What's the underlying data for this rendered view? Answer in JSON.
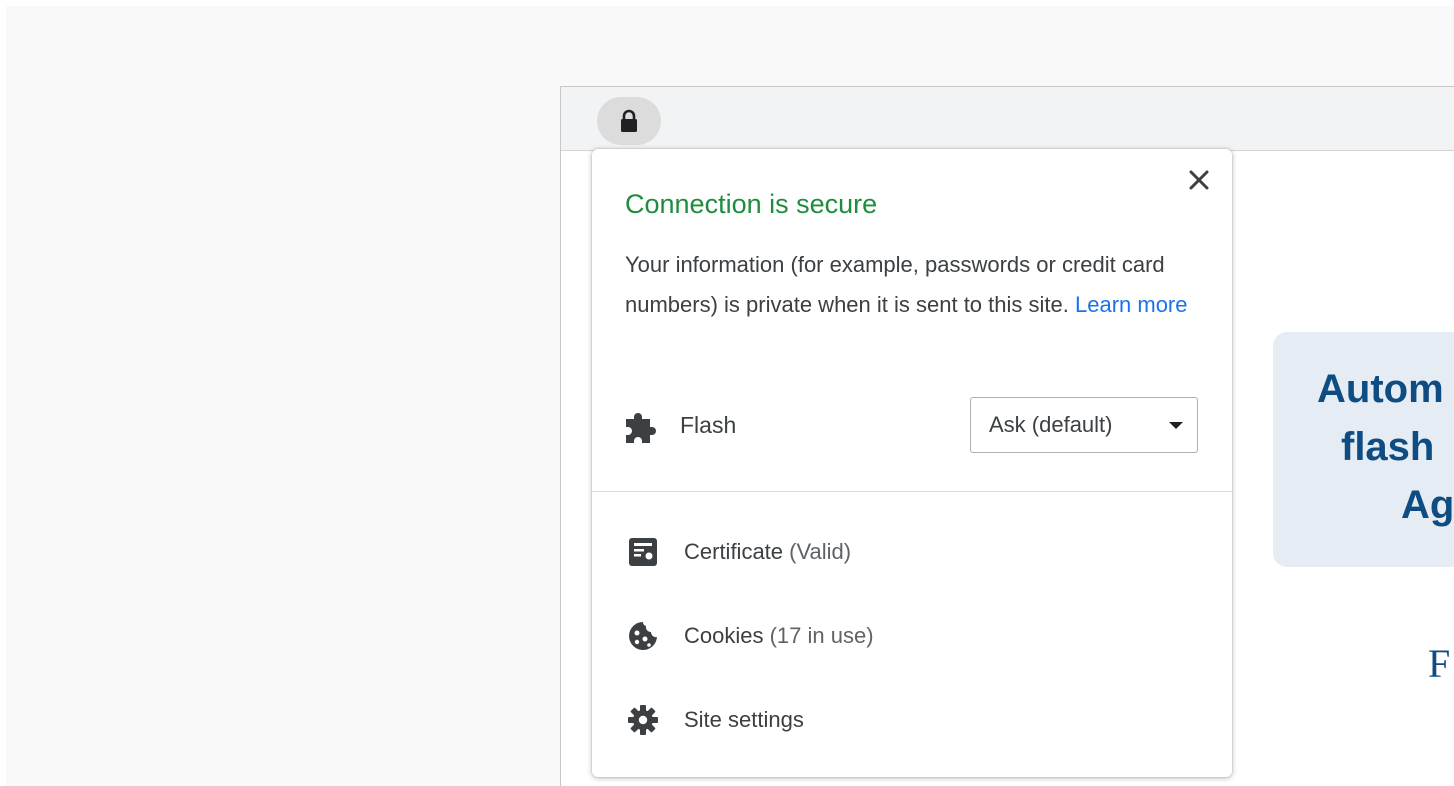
{
  "address_bar": {
    "lock_icon": "lock-icon"
  },
  "background_page": {
    "card_lines": [
      "Autom",
      "flash",
      "Ag"
    ],
    "serif_text": "F"
  },
  "site_info_popup": {
    "title": "Connection is secure",
    "title_color": "#1e8e3e",
    "description": "Your information (for example, passwords or credit card numbers) is private when it is sent to this site.",
    "learn_more": "Learn more",
    "link_color": "#1a73e8",
    "close_icon": "close-icon",
    "permission": {
      "icon": "puzzle-piece-icon",
      "label": "Flash",
      "value": "Ask (default)"
    },
    "items": [
      {
        "icon": "certificate-icon",
        "label": "Certificate",
        "detail": "(Valid)"
      },
      {
        "icon": "cookie-icon",
        "label": "Cookies",
        "detail": "(17 in use)"
      },
      {
        "icon": "gear-icon",
        "label": "Site settings",
        "detail": ""
      }
    ]
  }
}
